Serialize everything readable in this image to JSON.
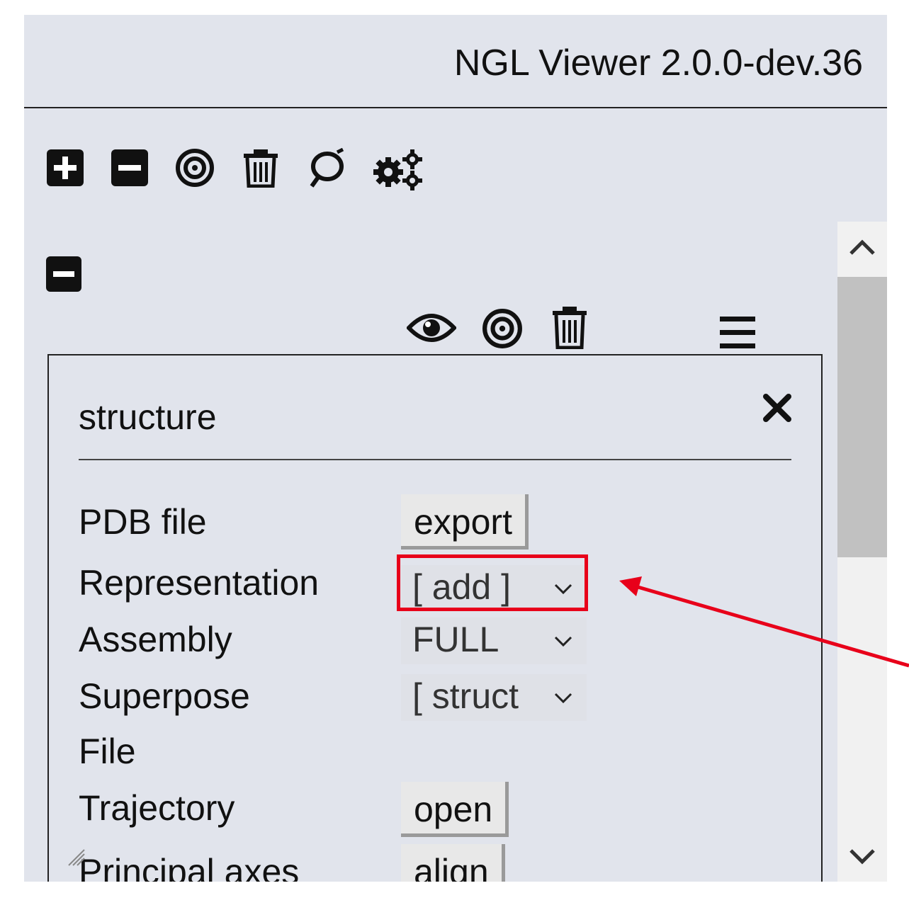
{
  "header": {
    "title": "NGL Viewer 2.0.0-dev.36"
  },
  "toolbar": {
    "icons": [
      "plus-square-icon",
      "minus-square-icon",
      "bullseye-icon",
      "trash-icon",
      "refresh-loop-icon",
      "gears-icon"
    ]
  },
  "component": {
    "name": "structure",
    "header_icons": [
      "eye-icon",
      "bullseye-icon",
      "trash-icon",
      "menu-icon"
    ],
    "rows": {
      "pdb_file": {
        "label": "PDB file",
        "button": "export"
      },
      "representation": {
        "label": "Representation",
        "select_value": "[ add ]"
      },
      "assembly": {
        "label": "Assembly",
        "select_value": "FULL"
      },
      "superpose": {
        "label": "Superpose",
        "select_value": "[ struct"
      },
      "file": {
        "label": "File"
      },
      "trajectory": {
        "label": "Trajectory",
        "button": "open"
      },
      "principal_axes": {
        "label": "Principal axes",
        "button": "align"
      }
    }
  },
  "annotation": {
    "highlight_color": "#e8001a"
  },
  "colors": {
    "panel_bg": "#e1e4ec",
    "accent": "#e8001a"
  }
}
